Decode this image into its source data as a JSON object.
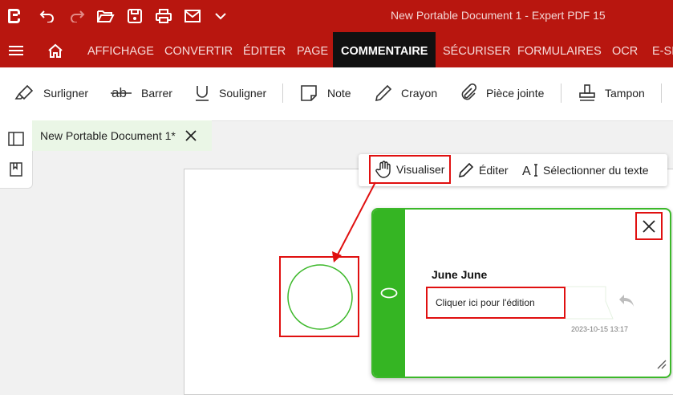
{
  "window": {
    "title": "New Portable Document 1   -   Expert PDF 15"
  },
  "quick_access": {
    "icons": [
      "app-logo-icon",
      "undo-icon",
      "redo-icon",
      "open-folder-icon",
      "save-icon",
      "print-icon",
      "email-icon",
      "chevron-down-icon"
    ]
  },
  "menu": {
    "items": [
      "AFFICHAGE",
      "CONVERTIR",
      "ÉDITER",
      "PAGE",
      "COMMENTAIRE",
      "SÉCURISER",
      "FORMULAIRES",
      "OCR",
      "E-SI"
    ],
    "active": "COMMENTAIRE"
  },
  "ribbon": {
    "highlight": "Surligner",
    "strike": "Barrer",
    "underline": "Souligner",
    "note": "Note",
    "pencil": "Crayon",
    "attachment": "Pièce jointe",
    "stamp": "Tampon"
  },
  "doc_tab": {
    "label": "New Portable Document 1*"
  },
  "mode_toolbar": {
    "view": "Visualiser",
    "edit": "Éditer",
    "select_text": "Sélectionner du texte"
  },
  "note_popup": {
    "author": "June June",
    "reply_placeholder": "Cliquer ici pour l'édition",
    "timestamp": "2023-10-15 13:17"
  },
  "colors": {
    "title_bar": "#b8160f",
    "active_tab": "#111111",
    "note_green": "#35b523",
    "callout_red": "#e01010"
  }
}
